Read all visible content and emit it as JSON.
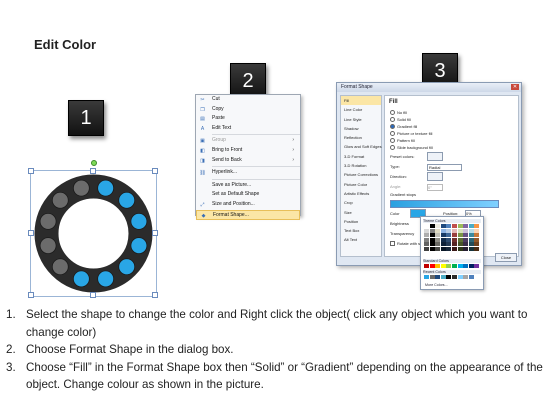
{
  "title": "Edit Color",
  "steps_badges": [
    "1",
    "2",
    "3"
  ],
  "ring": {
    "dot_colors": [
      "#29a6e6",
      "#29a6e6",
      "#29a6e6",
      "#29a6e6",
      "#29a6e6",
      "#29a6e6",
      "#29a6e6",
      "#6b6b6b",
      "#6b6b6b",
      "#6b6b6b",
      "#6b6b6b",
      "#6b6b6b"
    ],
    "ring_color": "#2b2b2b"
  },
  "context_menu": {
    "items": [
      {
        "label": "Cut",
        "icon": "scissors-icon",
        "glyph": "✂",
        "disabled": false
      },
      {
        "label": "Copy",
        "icon": "copy-icon",
        "glyph": "❐",
        "disabled": false
      },
      {
        "label": "Paste",
        "icon": "paste-icon",
        "glyph": "▤",
        "disabled": false
      },
      {
        "label": "Edit Text",
        "icon": "edit-text-icon",
        "glyph": "A",
        "disabled": false
      },
      {
        "label": "Group",
        "icon": "group-icon",
        "glyph": "▣",
        "disabled": true,
        "submenu": true
      },
      {
        "label": "Bring to Front",
        "icon": "bring-front-icon",
        "glyph": "◧",
        "disabled": false,
        "submenu": true
      },
      {
        "label": "Send to Back",
        "icon": "send-back-icon",
        "glyph": "◨",
        "disabled": false,
        "submenu": true
      },
      {
        "label": "Hyperlink...",
        "icon": "hyperlink-icon",
        "glyph": "⛓",
        "disabled": false
      },
      {
        "label": "Save as Picture...",
        "icon": "",
        "glyph": "",
        "disabled": false
      },
      {
        "label": "Set as Default Shape",
        "icon": "",
        "glyph": "",
        "disabled": false
      },
      {
        "label": "Size and Position...",
        "icon": "size-icon",
        "glyph": "⤢",
        "disabled": false
      },
      {
        "label": "Format Shape...",
        "icon": "format-shape-icon",
        "glyph": "◆",
        "disabled": false,
        "highlighted": true
      }
    ]
  },
  "dialog": {
    "title": "Format Shape",
    "categories": [
      "Fill",
      "Line Color",
      "Line Style",
      "Shadow",
      "Reflection",
      "Glow and Soft Edges",
      "3-D Format",
      "3-D Rotation",
      "Picture Corrections",
      "Picture Color",
      "Artistic Effects",
      "Crop",
      "Size",
      "Position",
      "Text Box",
      "Alt Text"
    ],
    "fill_heading": "Fill",
    "fill_options": [
      "No fill",
      "Solid fill",
      "Gradient fill",
      "Picture or texture fill",
      "Pattern fill",
      "Slide background fill"
    ],
    "fill_selected": 2,
    "preset_label": "Preset colors:",
    "type_label": "Type:",
    "type_value": "Radial",
    "direction_label": "Direction:",
    "angle_label": "Angle:",
    "angle_value": "0°",
    "stops_label": "Gradient stops",
    "color_label": "Color",
    "position_label": "Position:",
    "position_value": "0%",
    "brightness_label": "Brightness",
    "transparency_label": "Transparency",
    "rotate_label": "Rotate with shape",
    "close_label": "Close"
  },
  "palette": {
    "theme_label": "Theme Colors",
    "standard_label": "Standard Colors",
    "recent_label": "Recent Colors",
    "more_label": "More Colors...",
    "theme_top": [
      "#ffffff",
      "#000000",
      "#eeece1",
      "#1f497d",
      "#4f81bd",
      "#c0504d",
      "#9bbb59",
      "#8064a2",
      "#4bacc6",
      "#f79646"
    ],
    "theme_shades": [
      "#d9d9d9",
      "#7f7f7f",
      "#ddd9c3",
      "#8db3e2",
      "#b8cce4",
      "#e5b9b7",
      "#d7e3bc",
      "#ccc1d9",
      "#b7dde8",
      "#fbd5b5"
    ],
    "standard": [
      "#c00000",
      "#ff0000",
      "#ffc000",
      "#ffff00",
      "#92d050",
      "#00b050",
      "#00b0f0",
      "#0070c0",
      "#002060",
      "#7030a0"
    ],
    "recent": [
      "#29a6e6",
      "#6b6b6b",
      "#1f497d",
      "#4bacc6",
      "#000000",
      "#2b2b2b",
      "#7fd0ff",
      "#a5a5a5",
      "#4f81bd",
      "#ffffff"
    ]
  },
  "instructions": [
    {
      "num": "1.",
      "text": "Select the shape to change the color and Right click the object( click any object which you want to change color)"
    },
    {
      "num": "2.",
      "text": "Choose Format Shape in the dialog box."
    },
    {
      "num": "3.",
      "text": "Choose “Fill” in the Format Shape box then “Solid” or “Gradient” depending on the appearance of the object. Change colour as shown in the picture."
    }
  ]
}
